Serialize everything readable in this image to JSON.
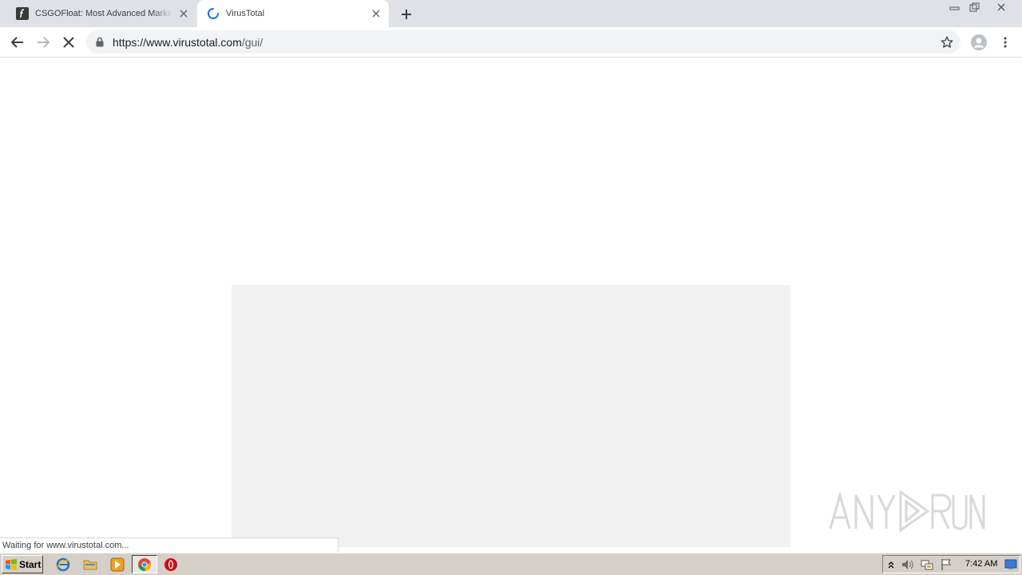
{
  "browser": {
    "tabs": [
      {
        "title": "CSGOFloat: Most Advanced Marketplace",
        "active": false,
        "favicon": "csgofloat-icon"
      },
      {
        "title": "VirusTotal",
        "active": true,
        "favicon": "loading-spinner-icon"
      }
    ],
    "address_bar": {
      "url_host": "https://www.virustotal.com",
      "url_path": "/gui/",
      "secure": true
    },
    "status_text": "Waiting for www.virustotal.com..."
  },
  "watermark": {
    "text": "ANY RUN"
  },
  "taskbar": {
    "start_label": "Start",
    "quick_launch": [
      "internet-explorer-icon",
      "folder-icon",
      "media-player-icon"
    ],
    "running": [
      "chrome-icon",
      "opera-icon"
    ],
    "clock": "7:42 AM"
  },
  "colors": {
    "tabstrip": "#dee1e6",
    "omnibox": "#f1f3f4",
    "spinner": "#1a73e8",
    "taskbar": "#d4d0c8"
  }
}
